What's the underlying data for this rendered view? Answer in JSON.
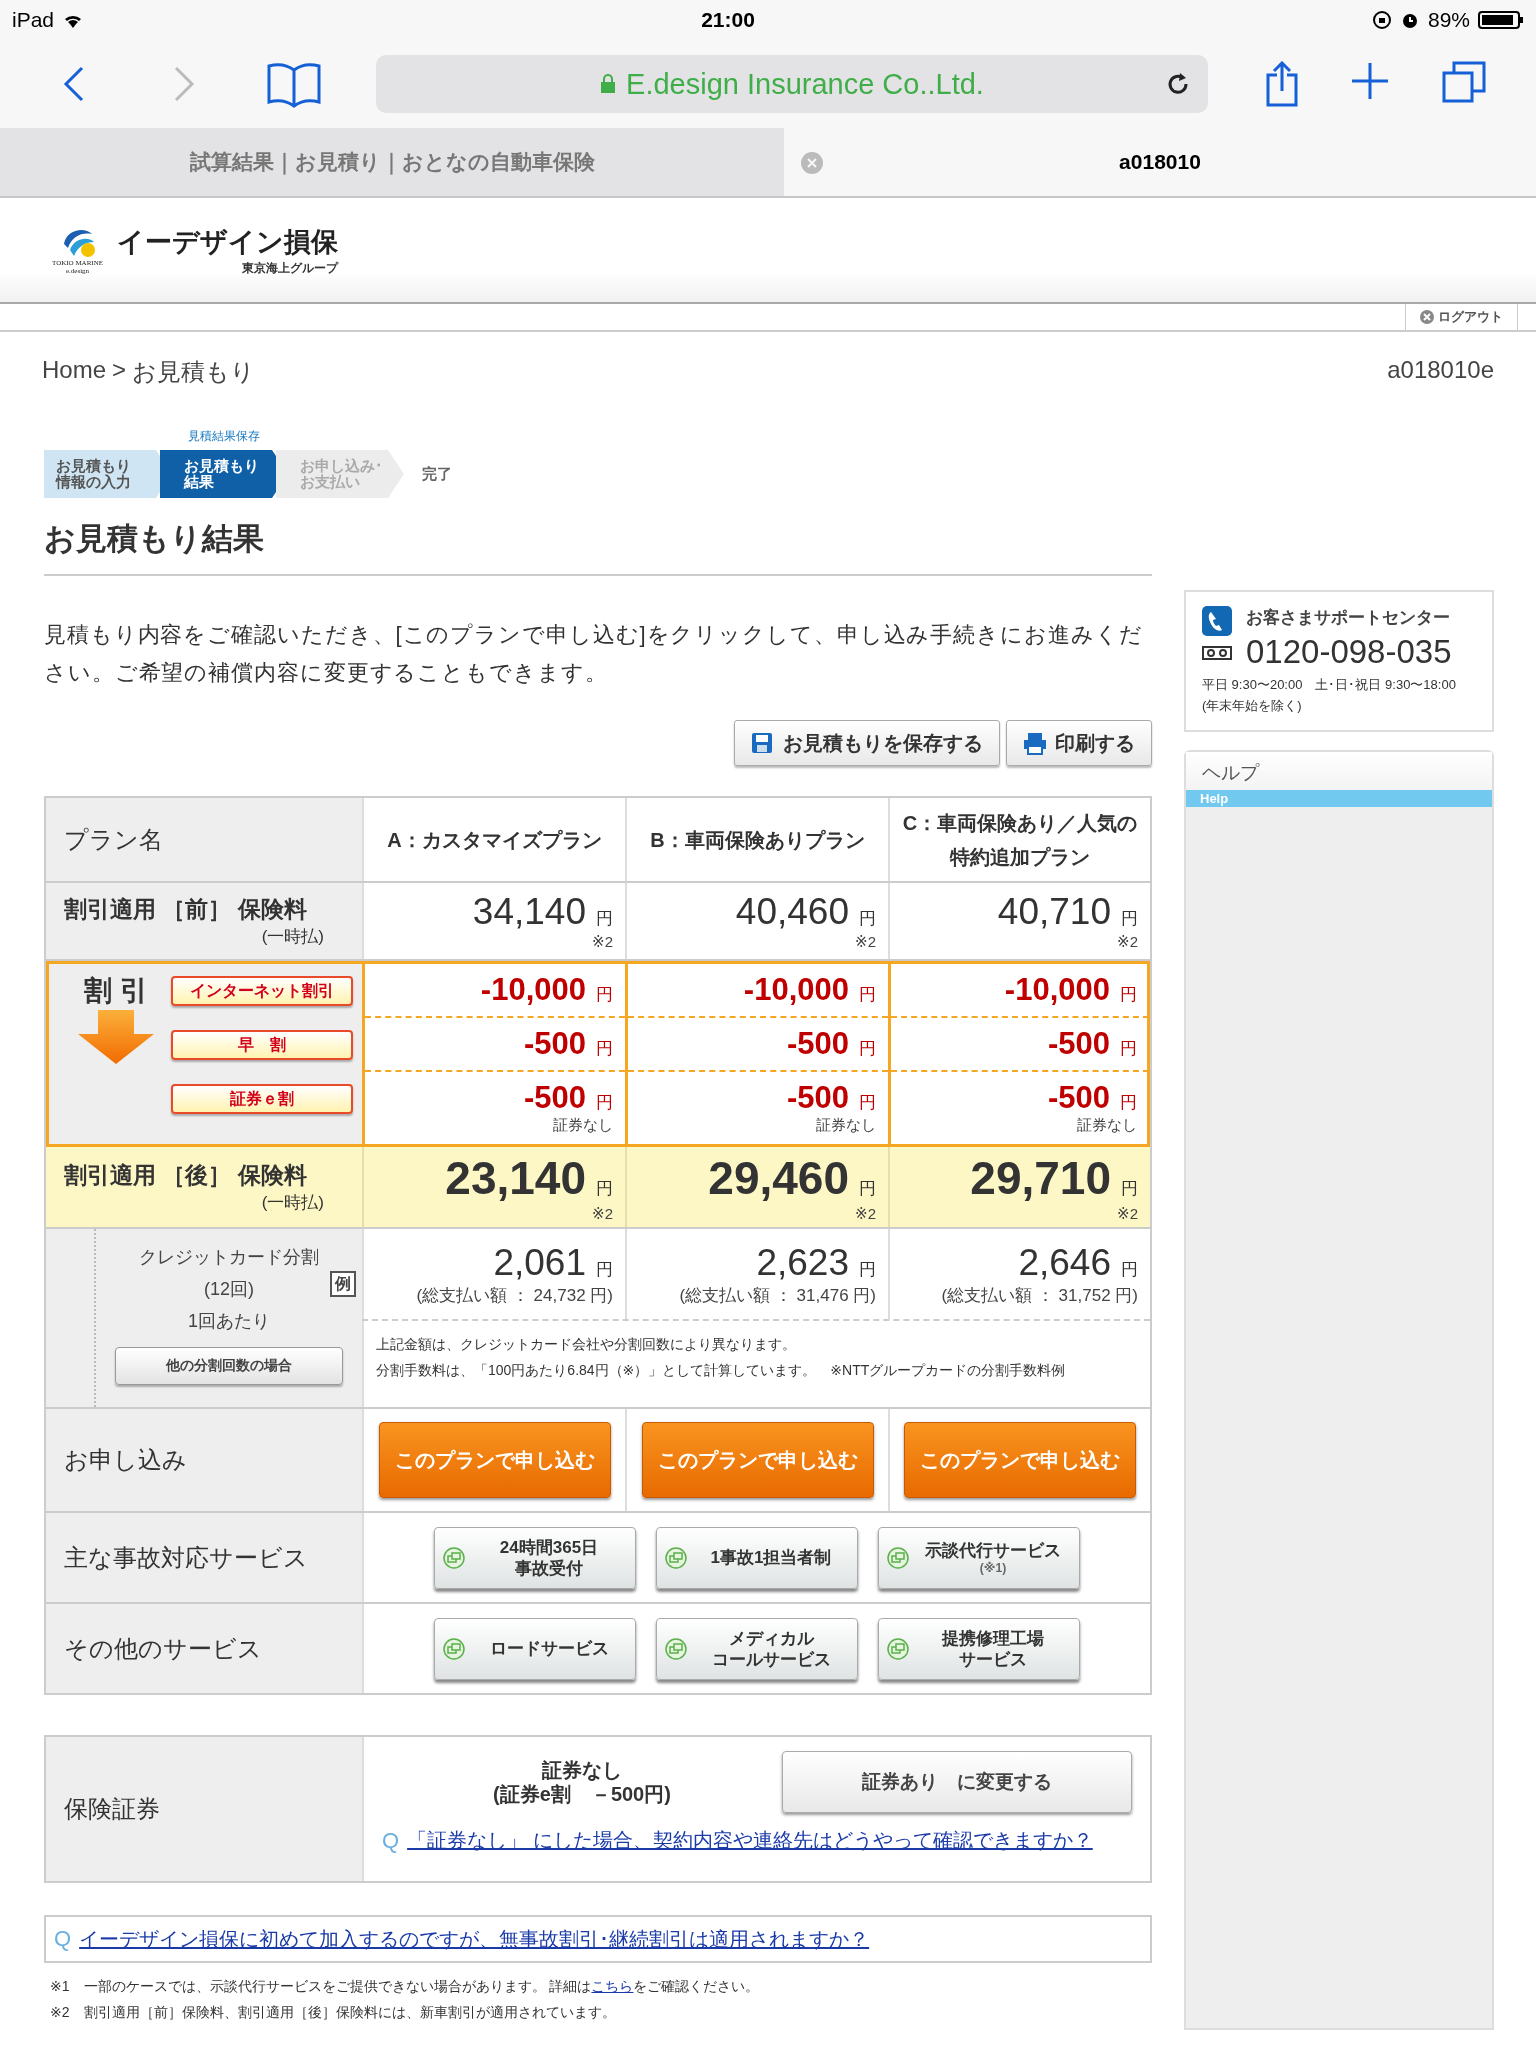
{
  "status_bar": {
    "device": "iPad",
    "time": "21:00",
    "battery": "89%"
  },
  "browser": {
    "back_enabled": true,
    "forward_enabled": false,
    "address": "E.design Insurance Co..Ltd.",
    "tabs": [
      {
        "title": "試算結果｜お見積り｜おとなの自動車保険",
        "selected": false
      },
      {
        "title": "a018010",
        "selected": true
      }
    ]
  },
  "site": {
    "logo_text": [
      "TOKIO MARINE",
      "e.design"
    ],
    "brand": "イーデザイン損保",
    "brand_sub": "東京海上グループ",
    "logout": "ログアウト"
  },
  "breadcrumb": {
    "items": [
      "Home",
      "お見積もり"
    ],
    "separator": ">"
  },
  "page_code": "a018010e",
  "steps": [
    {
      "lines": [
        "お見積もり",
        "情報の入力"
      ],
      "kind": "box",
      "done": true,
      "selected": false
    },
    {
      "lines": [
        "お見積もり",
        "結果"
      ],
      "kind": "box",
      "done": false,
      "selected": true,
      "note": "見積結果保存"
    },
    {
      "lines": [
        "お申し込み･",
        "お支払い"
      ],
      "kind": "box",
      "done": false,
      "selected": false
    },
    {
      "lines": [
        "完了"
      ],
      "kind": "end",
      "done": false,
      "selected": false
    }
  ],
  "title": "お見積もり結果",
  "intro": "見積もり内容をご確認いただき、[このプランで申し込む]をクリックして、申し込み手続きにお進みください。ご希望の補償内容に変更することもできます。",
  "actions": [
    {
      "label": "お見積もりを保存する",
      "kind": "save"
    },
    {
      "label": "印刷する",
      "kind": "print"
    }
  ],
  "table": {
    "header_label": "プラン名",
    "before_label": "割引適用 ［前］ 保険料",
    "before_sub": "(一時払)",
    "discount_label": "割 引",
    "discount_names": [
      "インターネット割引",
      "早　割",
      "証券ｅ割"
    ],
    "after_label": "割引適用 ［後］ 保険料",
    "after_sub": "(一時払)",
    "credit_lines": [
      "クレジットカード分割",
      "(12回)",
      "1回あたり"
    ],
    "credit_example": "例",
    "credit_button": "他の分割回数の場合",
    "credit_notes": [
      "上記金額は、クレジットカード会社や分割回数により異なります。",
      "分割手数料は、「100円あたり6.84円（※）」として計算しています。　※NTTグループカードの分割手数料例"
    ],
    "apply_label": "お申し込み",
    "plans": [
      {
        "name": "A：カスタマイズプラン",
        "before": {
          "amount": "34,140",
          "unit": "円",
          "note": "※2"
        },
        "discounts": [
          {
            "amount": "-10,000",
            "unit": "円"
          },
          {
            "amount": "-500",
            "unit": "円"
          },
          {
            "amount": "-500",
            "unit": "円",
            "note": "証券なし"
          }
        ],
        "after": {
          "amount": "23,140",
          "unit": "円",
          "note": "※2"
        },
        "monthly": {
          "amount": "2,061",
          "unit": "円"
        },
        "total": "(総支払い額 ： 24,732 円)",
        "apply": "このプランで申し込む"
      },
      {
        "name": "B：車両保険ありプラン",
        "before": {
          "amount": "40,460",
          "unit": "円",
          "note": "※2"
        },
        "discounts": [
          {
            "amount": "-10,000",
            "unit": "円"
          },
          {
            "amount": "-500",
            "unit": "円"
          },
          {
            "amount": "-500",
            "unit": "円",
            "note": "証券なし"
          }
        ],
        "after": {
          "amount": "29,460",
          "unit": "円",
          "note": "※2"
        },
        "monthly": {
          "amount": "2,623",
          "unit": "円"
        },
        "total": "(総支払い額 ： 31,476 円)",
        "apply": "このプランで申し込む"
      },
      {
        "name": "C：車両保険あり／人気の特約追加プラン",
        "before": {
          "amount": "40,710",
          "unit": "円",
          "note": "※2"
        },
        "discounts": [
          {
            "amount": "-10,000",
            "unit": "円"
          },
          {
            "amount": "-500",
            "unit": "円"
          },
          {
            "amount": "-500",
            "unit": "円",
            "note": "証券なし"
          }
        ],
        "after": {
          "amount": "29,710",
          "unit": "円",
          "note": "※2"
        },
        "monthly": {
          "amount": "2,646",
          "unit": "円"
        },
        "total": "(総支払い額 ： 31,752 円)",
        "apply": "このプランで申し込む"
      }
    ],
    "services": [
      {
        "label": "主な事故対応サービス",
        "buttons": [
          {
            "lines": [
              "24時間365日",
              "事故受付"
            ]
          },
          {
            "lines": [
              "1事故1担当者制"
            ]
          },
          {
            "lines": [
              "示談代行サービス"
            ],
            "note": "(※1)"
          }
        ]
      },
      {
        "label": "その他のサービス",
        "buttons": [
          {
            "lines": [
              "ロードサービス"
            ]
          },
          {
            "lines": [
              "メディカル",
              "コールサービス"
            ]
          },
          {
            "lines": [
              "提携修理工場",
              "サービス"
            ]
          }
        ]
      }
    ]
  },
  "certificate": {
    "label": "保険証券",
    "status": "証券なし",
    "status_sub": "(証券e割　－500円)",
    "button": "証券あり　に変更する",
    "q_mark": "Q",
    "question": "「証券なし」 にした場合、契約内容や連絡先はどうやって確認できますか？"
  },
  "faq": {
    "q_mark": "Q",
    "question": "イーデザイン損保に初めて加入するのですが、無事故割引･継続割引は適用されますか？"
  },
  "footnotes": [
    {
      "mark": "※1",
      "text": "一部のケースでは、示談代行サービスをご提供できない場合があります。 詳細は",
      "link": "こちら",
      "after": "をご確認ください。"
    },
    {
      "mark": "※2",
      "text": "割引適用［前］保険料、割引適用［後］保険料には、新車割引が適用されています。"
    }
  ],
  "sidebar": {
    "support_title": "お客さまサポートセンター",
    "phone": "0120-098-035",
    "hours": "平日 9:30〜20:00　土･日･祝日 9:30〜18:00",
    "hours_note": "(年末年始を除く)",
    "help_title": "ヘルプ",
    "help_sub": "Help"
  }
}
